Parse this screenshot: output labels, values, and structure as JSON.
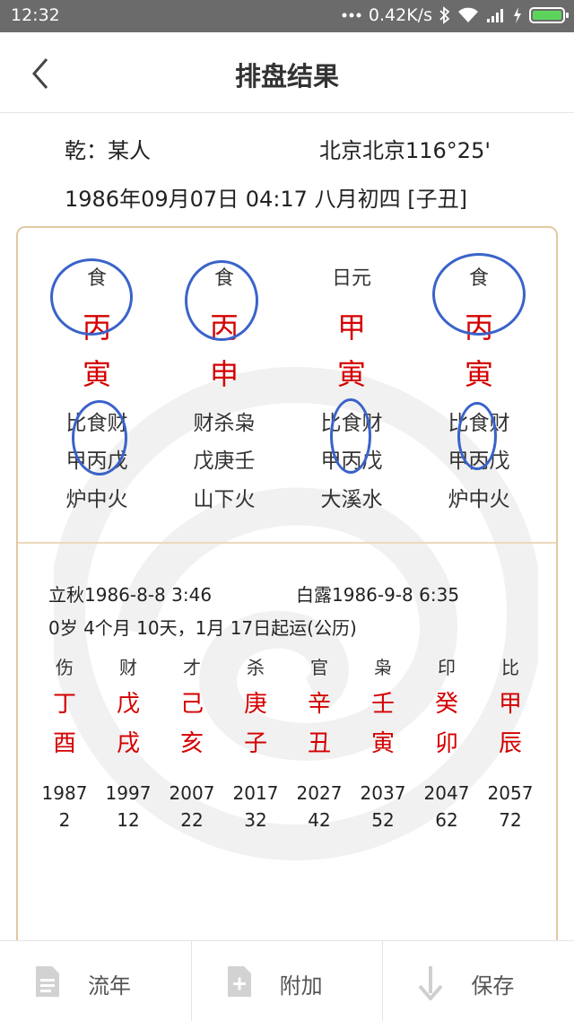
{
  "status_bar": {
    "time": "12:32",
    "network_speed": "0.42K/s",
    "icons": [
      "dots-icon",
      "bluetooth-icon",
      "wifi-icon",
      "signal-icon",
      "charging-icon",
      "battery-icon"
    ]
  },
  "nav": {
    "title": "排盘结果",
    "back_icon": "back-chevron-icon"
  },
  "person": {
    "line1": "乾：某人",
    "location": "北京北京116°25'",
    "line2": "1986年09月07日 04:17  八月初四 [子丑]"
  },
  "pillars": [
    {
      "shishen": "食",
      "stem": "丙",
      "branch": "寅",
      "hidden_shishen": "比食财",
      "hidden_stems": "甲丙戊",
      "nayin": "炉中火"
    },
    {
      "shishen": "食",
      "stem": "丙",
      "branch": "申",
      "hidden_shishen": "财杀枭",
      "hidden_stems": "戊庚壬",
      "nayin": "山下火"
    },
    {
      "shishen": "日元",
      "stem": "甲",
      "branch": "寅",
      "hidden_shishen": "比食财",
      "hidden_stems": "甲丙戊",
      "nayin": "大溪水"
    },
    {
      "shishen": "食",
      "stem": "丙",
      "branch": "寅",
      "hidden_shishen": "比食财",
      "hidden_stems": "甲丙戊",
      "nayin": "炉中火"
    }
  ],
  "jieqi": {
    "prev": "立秋1986-8-8 3:46",
    "next": "白露1986-9-8 6:35",
    "qiyun": "0岁 4个月 10天，1月 17日起运(公历)"
  },
  "dayun": [
    {
      "shishen": "伤",
      "stem": "丁",
      "branch": "酉",
      "year": "1987",
      "age": "2"
    },
    {
      "shishen": "财",
      "stem": "戊",
      "branch": "戌",
      "year": "1997",
      "age": "12"
    },
    {
      "shishen": "才",
      "stem": "己",
      "branch": "亥",
      "year": "2007",
      "age": "22"
    },
    {
      "shishen": "杀",
      "stem": "庚",
      "branch": "子",
      "year": "2017",
      "age": "32"
    },
    {
      "shishen": "官",
      "stem": "辛",
      "branch": "丑",
      "year": "2027",
      "age": "42"
    },
    {
      "shishen": "枭",
      "stem": "壬",
      "branch": "寅",
      "year": "2037",
      "age": "52"
    },
    {
      "shishen": "印",
      "stem": "癸",
      "branch": "卯",
      "year": "2047",
      "age": "62"
    },
    {
      "shishen": "比",
      "stem": "甲",
      "branch": "辰",
      "year": "2057",
      "age": "72"
    }
  ],
  "tabs": [
    {
      "label": "流年",
      "icon": "document-icon"
    },
    {
      "label": "附加",
      "icon": "add-document-icon"
    },
    {
      "label": "保存",
      "icon": "download-arrow-icon"
    }
  ],
  "colors": {
    "stem_branch": "#d40000",
    "panel_border": "#e2c9a3",
    "annotation_circle": "#3a63c9",
    "battery": "#5cd45c"
  }
}
